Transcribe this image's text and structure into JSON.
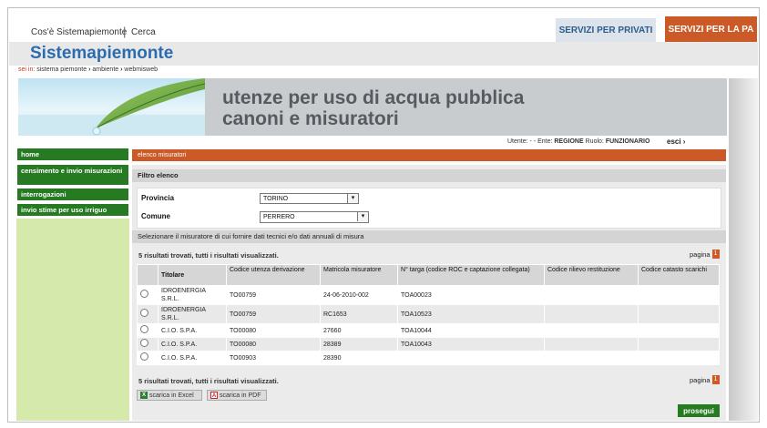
{
  "header": {
    "links": [
      "Cos'è Sistemapiemonte",
      "Cerca"
    ],
    "separator": "|",
    "tabs": [
      "SERVIZI PER PRIVATI",
      "SERVIZI PER LA PA"
    ],
    "site_title": "Sistemapiemonte",
    "breadcrumb_label": "sei in:",
    "breadcrumb": [
      "sistema piemonte",
      "ambiente",
      "webmisweb"
    ]
  },
  "banner": {
    "title_line1": "utenze per uso di acqua pubblica",
    "title_line2": "canoni e misuratori"
  },
  "userbar": {
    "prefix": "Utente: - - Ente:",
    "ente": "REGIONE",
    "ruolo_label": "Ruolo:",
    "ruolo": "FUNZIONARIO",
    "logout": "esci ›"
  },
  "sidebar": {
    "items": [
      "home",
      "censimento e invio misurazioni",
      "interrogazioni",
      "invio stime per uso irriguo"
    ]
  },
  "main": {
    "bar_title": "elenco misuratori",
    "filter_title": "Filtro elenco",
    "filters": {
      "provincia_label": "Provincia",
      "provincia_value": "TORINO",
      "comune_label": "Comune",
      "comune_value": "PERRERO"
    },
    "select_title": "Selezionare il misuratore di cui fornire dati tecnici e/o dati annuali di misura",
    "results_text": "5 risultati trovati, tutti i risultati visualizzati.",
    "pagina_label": "pagina",
    "pagina_num": "1",
    "columns": [
      "Titolare",
      "Codice utenza derivazione",
      "Matricola misuratore",
      "N° targa (codice ROC e captazione collegata)",
      "Codice rilievo restituzione",
      "Codice catasto scarichi"
    ],
    "rows": [
      {
        "titolare": "IDROENERGIA S.R.L.",
        "codice": "TO00759",
        "matricola": "24-06-2010-002",
        "targa": "TOA00023",
        "rilievo": "",
        "catasto": ""
      },
      {
        "titolare": "IDROENERGIA S.R.L.",
        "codice": "TO00759",
        "matricola": "RC1653",
        "targa": "TOA10523",
        "rilievo": "",
        "catasto": ""
      },
      {
        "titolare": "C.I.O. S.P.A.",
        "codice": "TO00080",
        "matricola": "27660",
        "targa": "TOA10044",
        "rilievo": "",
        "catasto": ""
      },
      {
        "titolare": "C.I.O. S.P.A.",
        "codice": "TO00080",
        "matricola": "28389",
        "targa": "TOA10043",
        "rilievo": "",
        "catasto": ""
      },
      {
        "titolare": "C.I.O. S.P.A.",
        "codice": "TO00903",
        "matricola": "28390",
        "targa": "",
        "rilievo": "",
        "catasto": ""
      }
    ],
    "download_excel": "scarica in Excel",
    "download_pdf": "scarica in PDF",
    "next_button": "prosegui"
  },
  "colors": {
    "orange": "#cc5a26",
    "green": "#267b22",
    "blue_title": "#2b6cb0"
  }
}
